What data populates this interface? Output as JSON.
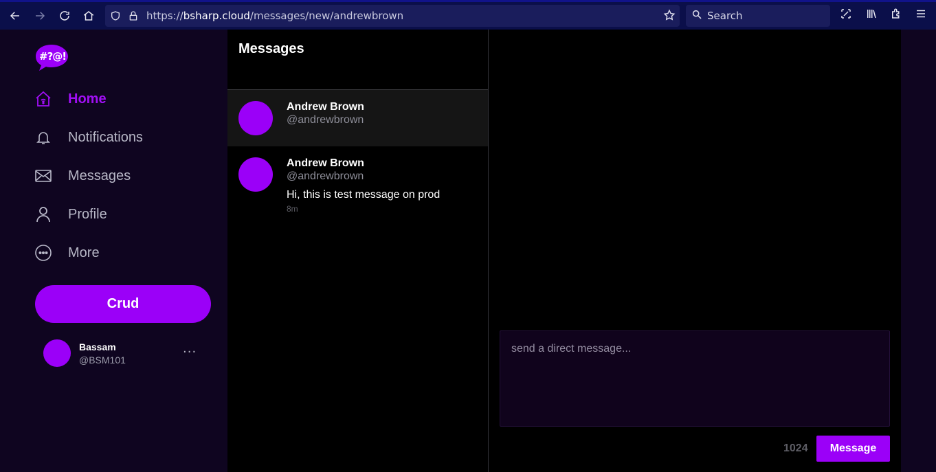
{
  "browser": {
    "url_scheme": "https://",
    "url_host": "bsharp.cloud",
    "url_path": "/messages/new/andrewbrown",
    "search_placeholder": "Search"
  },
  "logo": {
    "text": "#?@!"
  },
  "sidebar": {
    "items": [
      {
        "label": "Home",
        "icon": "home-icon",
        "active": true
      },
      {
        "label": "Notifications",
        "icon": "bell-icon",
        "active": false
      },
      {
        "label": "Messages",
        "icon": "envelope-icon",
        "active": false
      },
      {
        "label": "Profile",
        "icon": "user-icon",
        "active": false
      },
      {
        "label": "More",
        "icon": "more-circle-icon",
        "active": false
      }
    ],
    "crud_label": "Crud",
    "user": {
      "name": "Bassam",
      "handle": "@BSM101",
      "menu": "···"
    }
  },
  "messages": {
    "title": "Messages",
    "conversations": [
      {
        "name": "Andrew Brown",
        "handle": "@andrewbrown",
        "message": "",
        "time": ""
      },
      {
        "name": "Andrew Brown",
        "handle": "@andrewbrown",
        "message": "Hi, this is test message on prod",
        "time": "8m"
      }
    ]
  },
  "composer": {
    "placeholder": "send a direct message...",
    "char_count": "1024",
    "send_label": "Message"
  },
  "colors": {
    "accent": "#9b00f8",
    "sidebar_bg": "#0f0520",
    "browser_bar": "#0b0f4a"
  }
}
